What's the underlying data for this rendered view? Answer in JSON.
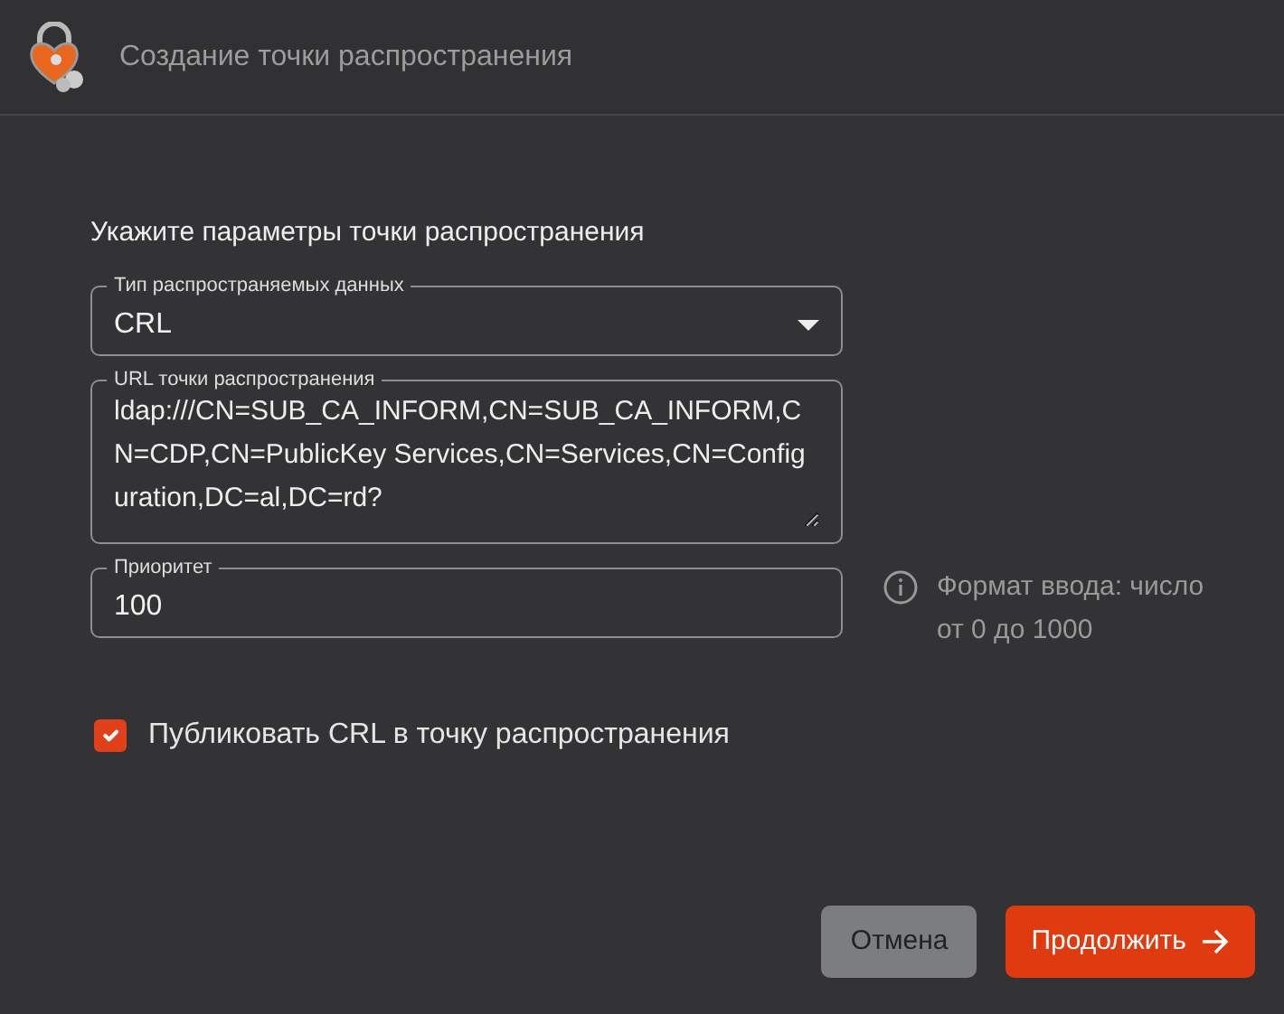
{
  "window": {
    "title": "Создание точки распространения"
  },
  "form": {
    "heading": "Укажите параметры точки распространения",
    "data_type": {
      "label": "Тип распространяемых данных",
      "value": "CRL"
    },
    "url": {
      "label": "URL точки распространения",
      "value": "ldap:///CN=SUB_CA_INFORM,CN=SUB_CA_INFORM,CN=CDP,CN=PublicKey Services,CN=Services,CN=Configuration,DC=al,DC=rd?"
    },
    "priority": {
      "label": "Приоритет",
      "value": "100",
      "hint": "Формат ввода: число от 0 до 1000"
    },
    "publish": {
      "label": "Публиковать CRL в точку распространения",
      "checked": true
    }
  },
  "buttons": [
    {
      "label": "Отмена",
      "kind": "secondary"
    },
    {
      "label": "Продолжить",
      "kind": "primary"
    }
  ]
}
